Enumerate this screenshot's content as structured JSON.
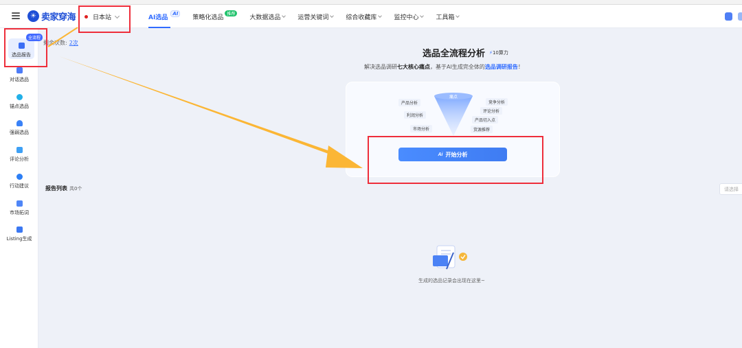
{
  "app": {
    "logo_text": "卖家穿海",
    "site": "日本站"
  },
  "nav": {
    "items": [
      {
        "label": "AI选品",
        "tag": "AI"
      },
      {
        "label": "策略化选品",
        "tag": "推荐"
      },
      {
        "label": "大数据选品"
      },
      {
        "label": "运营关键词"
      },
      {
        "label": "综合收藏库"
      },
      {
        "label": "监控中心"
      },
      {
        "label": "工具箱"
      }
    ]
  },
  "sidebar": {
    "badge": "全流程",
    "items": [
      {
        "label": "选品报告"
      },
      {
        "label": "对话选品"
      },
      {
        "label": "锚点选品"
      },
      {
        "label": "强弱选品"
      },
      {
        "label": "评论分析"
      },
      {
        "label": "行动建议"
      },
      {
        "label": "市场拓词"
      },
      {
        "label": "Listing生成"
      }
    ]
  },
  "main": {
    "usage_label": "剩余次数:",
    "usage_value": "2次",
    "title": "选品全流程分析",
    "power_value": "10",
    "power_unit": "算力",
    "subtitle_pre": "解决选品调研",
    "subtitle_bold": "七大核心痛点",
    "subtitle_mid": "，基于AI生成完全体的",
    "subtitle_blue": "选品调研报告",
    "subtitle_end": "！",
    "funnel_top": "痛点",
    "funnel_labels": [
      "产品分析",
      "利润分析",
      "市场分析",
      "竞争分析",
      "评论分析",
      "产品切入点",
      "货源推荐"
    ],
    "start_button": "开始分析",
    "report_list_title": "报告列表",
    "report_count": "共0个",
    "select_placeholder": "请选择",
    "empty_text": "生成的选品记录会出现在这里~"
  },
  "colors": {
    "accent": "#2f6bff",
    "annotation_red": "#ee2d3a",
    "annotation_arrow": "#fbb635"
  }
}
